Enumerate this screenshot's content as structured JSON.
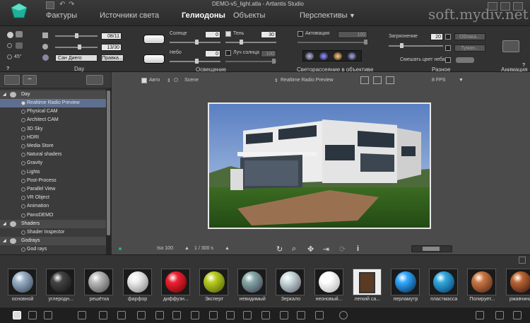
{
  "window": {
    "title": "DEMO-v5_light.atla - Artlantis Studio",
    "watermark": "soft.mydiv.net"
  },
  "tabs": [
    {
      "label": "Фактуры",
      "active": false
    },
    {
      "label": "Источники света",
      "active": false
    },
    {
      "label": "Гелиодоны",
      "active": true
    },
    {
      "label": "Объекты",
      "active": false
    },
    {
      "label": "Перспективы",
      "active": false
    }
  ],
  "day": {
    "date": "08/11",
    "time": "13/30",
    "city": "Сан Диего",
    "edit_button": "Правка...",
    "angle": "45°",
    "section": "Day",
    "help": "?"
  },
  "lighting": {
    "sun_label": "Солнце",
    "sun_value": "0",
    "sky_label": "Небо",
    "sky_value": "0",
    "shadow_label": "Тень",
    "shadow_value": "30",
    "sunray_label": "Луч солнца",
    "sunray_value": "100",
    "section": "Освещение"
  },
  "lens": {
    "activation_label": "Активация",
    "activation_value": "100",
    "section": "Светорассеяние в объективе"
  },
  "misc": {
    "pollution_label": "Загрязнение",
    "pollution_value": "20",
    "clouds_button": "Облака...",
    "fog_button": "Туман...",
    "mix_label": "Смешать цвет неба",
    "section": "Разное"
  },
  "animation": {
    "section": "Анимация",
    "help": "?"
  },
  "tree": {
    "groups": {
      "day": "Day",
      "shaders": "Shaders",
      "godrays": "Godrays"
    },
    "day_items": [
      "Realtime Radio Preview",
      "Physical CAM",
      "Architect CAM",
      "3D Sky",
      "HDRI",
      "Media Store",
      "Natural shaders",
      "Gravity",
      "Lights",
      "Post-Process",
      "Parallel View",
      "VR Object",
      "Animation",
      "PanoDEMO"
    ],
    "shader_items": [
      "Shader Inspector"
    ],
    "godray_items": [
      "God rays"
    ]
  },
  "viewport": {
    "auto_label": "Авто",
    "scene_label": "Scene",
    "preview_mode": "Realtime Radio Preview",
    "fps": "8 FPS",
    "iso": "Iso 100",
    "shutter": "1 / 300 s"
  },
  "materials": [
    "основной",
    "углеродн...",
    "решётка",
    "фарфор",
    "диффузн...",
    "Эксперт",
    "невидимый",
    "Зеркало",
    "неоновый...",
    "легкий са...",
    "перламутр",
    "пластмасса",
    "Полирует...",
    "ржавчина"
  ],
  "colors": {
    "accent": "#1fb19a",
    "selection": "#5f6f8f",
    "panel": "#323232",
    "viewport": "#4b4b4b"
  }
}
